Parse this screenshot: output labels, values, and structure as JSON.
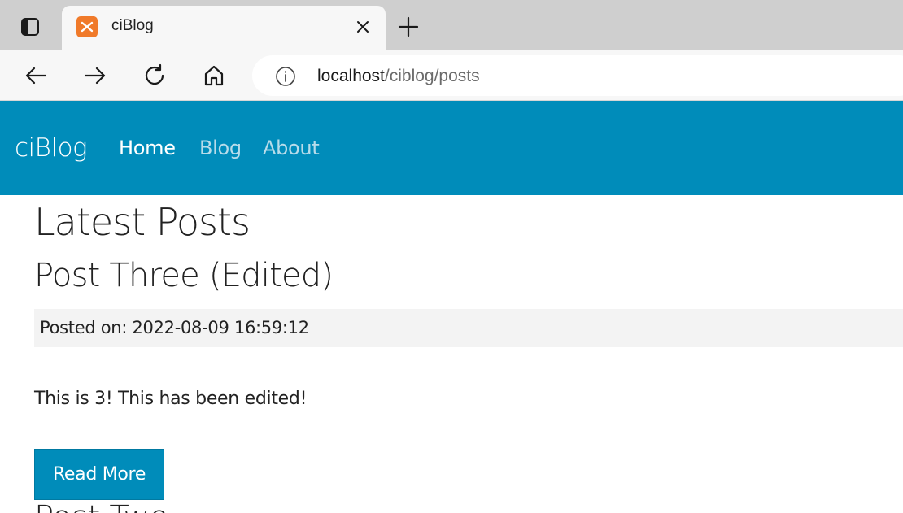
{
  "browser": {
    "tab": {
      "title": "ciBlog"
    },
    "address": {
      "host": "localhost",
      "path": "/ciblog/posts"
    }
  },
  "navbar": {
    "brand": "ciBlog",
    "links": [
      {
        "label": "Home"
      },
      {
        "label": "Blog"
      },
      {
        "label": "About"
      }
    ]
  },
  "main": {
    "heading": "Latest Posts",
    "posts": [
      {
        "title": "Post Three (Edited)",
        "posted_on": "Posted on: 2022-08-09 16:59:12",
        "body": "This is 3! This has been edited!",
        "read_more_label": "Read More"
      },
      {
        "title": "Post Two"
      }
    ]
  },
  "colors": {
    "navbar_bg": "#008cba",
    "button_bg": "#008cba",
    "meta_bg": "#f3f3f3",
    "tabbar_bg": "#cfcfcf"
  },
  "icons": [
    "sidebar-toggle-icon",
    "xampp-favicon-icon",
    "close-icon",
    "plus-icon",
    "back-arrow-icon",
    "forward-arrow-icon",
    "refresh-icon",
    "home-icon",
    "info-icon"
  ]
}
